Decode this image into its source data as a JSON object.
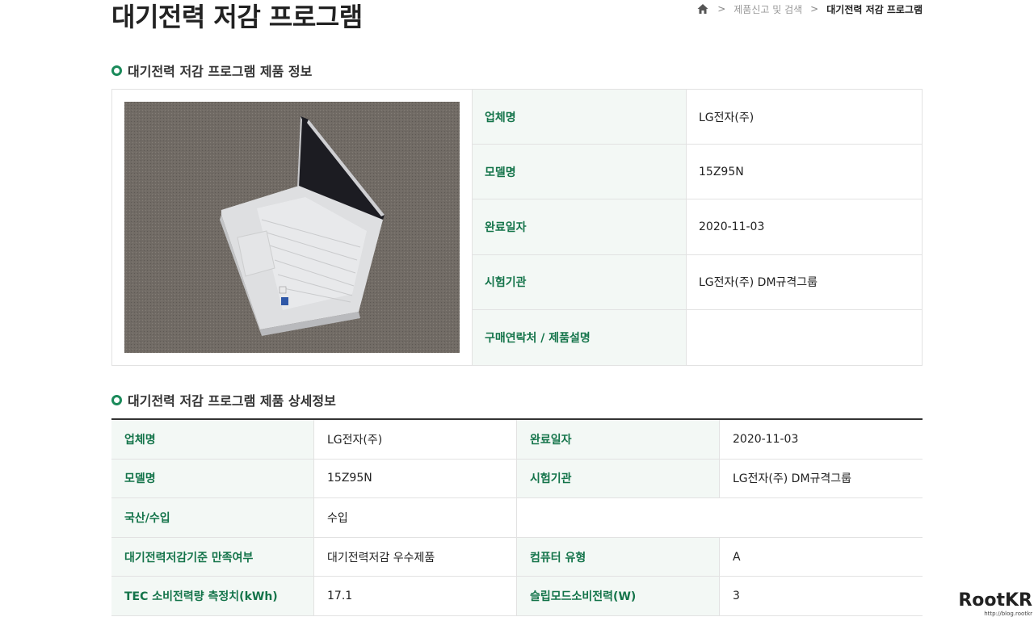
{
  "page": {
    "title": "대기전력 저감 프로그램"
  },
  "breadcrumb": {
    "home_icon": "home-icon",
    "items": [
      "제품신고 및 검색",
      "대기전력 저감 프로그램"
    ]
  },
  "section1": {
    "title": "대기전력 저감 프로그램 제품 정보",
    "rows": [
      {
        "label": "업체명",
        "value": "LG전자(주)"
      },
      {
        "label": "모델명",
        "value": "15Z95N"
      },
      {
        "label": "완료일자",
        "value": "2020-11-03"
      },
      {
        "label": "시험기관",
        "value": "LG전자(주) DM규격그룹"
      },
      {
        "label": "구매연락처 / 제품설명",
        "value": ""
      }
    ]
  },
  "section2": {
    "title": "대기전력 저감 프로그램 제품 상세정보",
    "rows": [
      {
        "l1": "업체명",
        "v1": "LG전자(주)",
        "l2": "완료일자",
        "v2": "2020-11-03"
      },
      {
        "l1": "모델명",
        "v1": "15Z95N",
        "l2": "시험기관",
        "v2": "LG전자(주) DM규격그룹"
      },
      {
        "l1": "국산/수입",
        "v1": "수입",
        "l2": "",
        "v2": ""
      },
      {
        "l1": "대기전력저감기준 만족여부",
        "v1": "대기전력저감 우수제품",
        "l2": "컴퓨터 유형",
        "v2": "A"
      },
      {
        "l1": "TEC 소비전력량 측정치(kWh)",
        "v1": "17.1",
        "l2": "슬립모드소비전력(W)",
        "v2": "3"
      }
    ]
  },
  "watermark": {
    "brand": "RootKR",
    "url": "http://blog.rootkr"
  },
  "colors": {
    "accent": "#1a8a5a",
    "label_text": "#14744a",
    "label_bg": "#f3f8f5"
  }
}
